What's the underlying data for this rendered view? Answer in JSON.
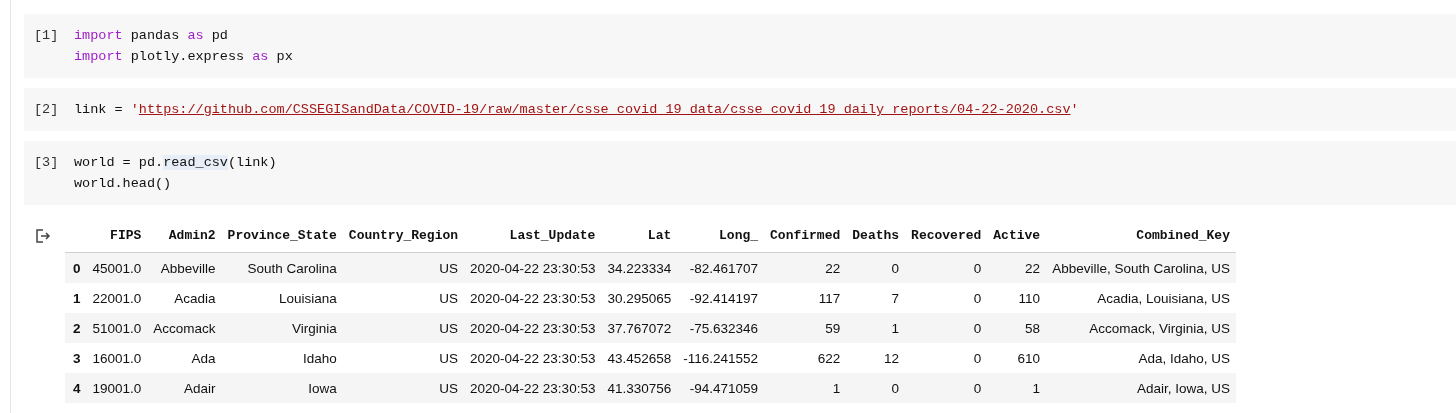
{
  "cells": [
    {
      "prompt": "[1]",
      "lines": [
        [
          {
            "kind": "keyword",
            "text": "import"
          },
          {
            "kind": "plain",
            "text": " pandas "
          },
          {
            "kind": "keyword",
            "text": "as"
          },
          {
            "kind": "plain",
            "text": " pd"
          }
        ],
        [
          {
            "kind": "keyword",
            "text": "import"
          },
          {
            "kind": "plain",
            "text": " plotly.express "
          },
          {
            "kind": "keyword",
            "text": "as"
          },
          {
            "kind": "plain",
            "text": " px"
          }
        ]
      ]
    },
    {
      "prompt": "[2]",
      "lines": [
        [
          {
            "kind": "plain",
            "text": "link = "
          },
          {
            "kind": "string",
            "text": "'"
          },
          {
            "kind": "url",
            "text": "https://github.com/CSSEGISandData/COVID-19/raw/master/csse_covid_19_data/csse_covid_19_daily_reports/04-22-2020.csv"
          },
          {
            "kind": "string",
            "text": "'"
          }
        ]
      ]
    },
    {
      "prompt": "[3]",
      "lines": [
        [
          {
            "kind": "plain",
            "text": "world = pd."
          },
          {
            "kind": "highlight",
            "text": "read_csv"
          },
          {
            "kind": "plain",
            "text": "(link)"
          }
        ],
        [
          {
            "kind": "plain",
            "text": "world.head()"
          }
        ]
      ]
    }
  ],
  "output": {
    "columns": [
      "FIPS",
      "Admin2",
      "Province_State",
      "Country_Region",
      "Last_Update",
      "Lat",
      "Long_",
      "Confirmed",
      "Deaths",
      "Recovered",
      "Active",
      "Combined_Key"
    ],
    "rows": [
      {
        "index": "0",
        "cells": [
          "45001.0",
          "Abbeville",
          "South Carolina",
          "US",
          "2020-04-22 23:30:53",
          "34.223334",
          "-82.461707",
          "22",
          "0",
          "0",
          "22",
          "Abbeville, South Carolina, US"
        ]
      },
      {
        "index": "1",
        "cells": [
          "22001.0",
          "Acadia",
          "Louisiana",
          "US",
          "2020-04-22 23:30:53",
          "30.295065",
          "-92.414197",
          "117",
          "7",
          "0",
          "110",
          "Acadia, Louisiana, US"
        ]
      },
      {
        "index": "2",
        "cells": [
          "51001.0",
          "Accomack",
          "Virginia",
          "US",
          "2020-04-22 23:30:53",
          "37.767072",
          "-75.632346",
          "59",
          "1",
          "0",
          "58",
          "Accomack, Virginia, US"
        ]
      },
      {
        "index": "3",
        "cells": [
          "16001.0",
          "Ada",
          "Idaho",
          "US",
          "2020-04-22 23:30:53",
          "43.452658",
          "-116.241552",
          "622",
          "12",
          "0",
          "610",
          "Ada, Idaho, US"
        ]
      },
      {
        "index": "4",
        "cells": [
          "19001.0",
          "Adair",
          "Iowa",
          "US",
          "2020-04-22 23:30:53",
          "41.330756",
          "-94.471059",
          "1",
          "0",
          "0",
          "1",
          "Adair, Iowa, US"
        ]
      }
    ]
  }
}
